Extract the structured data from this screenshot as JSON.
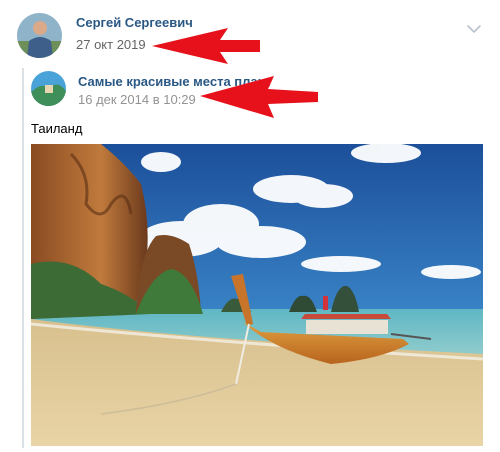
{
  "post": {
    "author_name": "Сергей Сергеевич",
    "date": "27 окт 2019",
    "repost": {
      "group_name": "Самые красивые места плане",
      "date": "16 дек 2014 в 10:29",
      "text": "Таиланд"
    }
  },
  "icons": {
    "menu": "chevron-down-icon",
    "annotation": "red-arrow-icon"
  },
  "colors": {
    "link": "#2a5885",
    "date": "#656565",
    "arrow": "#e6111a"
  }
}
